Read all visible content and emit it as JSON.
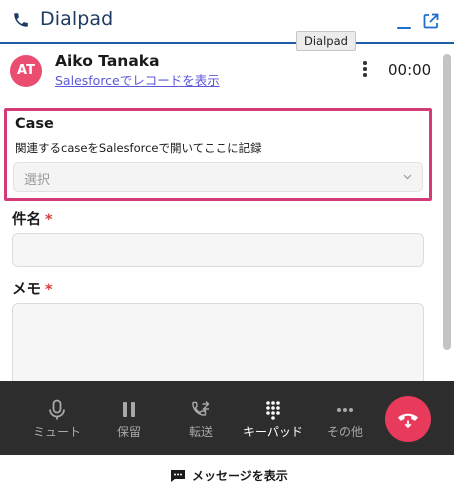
{
  "header": {
    "title": "Dialpad",
    "tooltip": "Dialpad"
  },
  "contact": {
    "initials": "AT",
    "name": "Aiko Tanaka",
    "link": "Salesforceでレコードを表示",
    "timer": "00:00",
    "avatar_color": "#ea4d70"
  },
  "case_panel": {
    "title": "Case",
    "description": "関連するcaseをSalesforceで開いてここに記録",
    "select_placeholder": "選択",
    "highlight_color": "#d63b79"
  },
  "form": {
    "subject_label": "件名",
    "memo_label": "メモ",
    "required_mark": "*"
  },
  "call_controls": {
    "items": [
      {
        "label": "ミュート",
        "icon": "microphone-icon"
      },
      {
        "label": "保留",
        "icon": "pause-icon"
      },
      {
        "label": "転送",
        "icon": "transfer-call-icon"
      },
      {
        "label": "キーパッド",
        "icon": "keypad-icon"
      },
      {
        "label": "その他",
        "icon": "more-horizontal-icon"
      }
    ],
    "hangup_icon": "hang-up-icon",
    "hangup_color": "#e83b5c"
  },
  "footer": {
    "show_messages_label": "メッセージを表示"
  },
  "colors": {
    "brand_blue": "#1e5ea8",
    "link_purple": "#5b57d9",
    "callbar_bg": "#2d2d2d"
  }
}
